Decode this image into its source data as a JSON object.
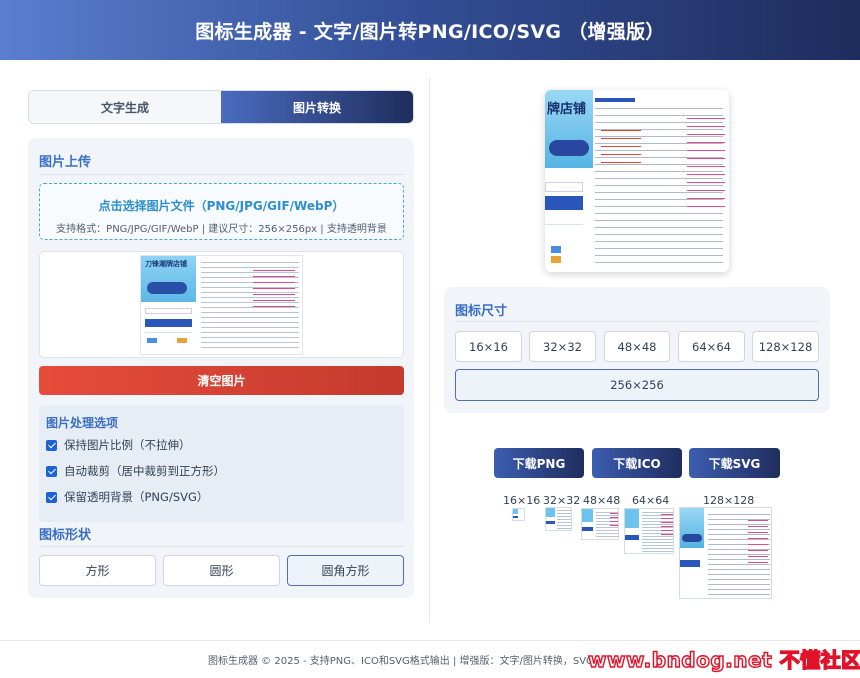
{
  "header": {
    "title": "图标生成器 - 文字/图片转PNG/ICO/SVG （增强版）"
  },
  "mode_tabs": [
    {
      "label": "文字生成",
      "active": false
    },
    {
      "label": "图片转换",
      "active": true
    }
  ],
  "upload": {
    "section_title": "图片上传",
    "dropzone_title": "点击选择图片文件（PNG/JPG/GIF/WebP）",
    "dropzone_hint": "支持格式：PNG/JPG/GIF/WebP | 建议尺寸：256×256px | 支持透明背景",
    "preview_image_title": "刀锋潮牌店铺",
    "clear_button": "清空图片"
  },
  "processing_options": {
    "title": "图片处理选项",
    "items": [
      {
        "label": "保持图片比例（不拉伸）",
        "checked": true
      },
      {
        "label": "自动裁剪（居中裁剪到正方形）",
        "checked": true
      },
      {
        "label": "保留透明背景（PNG/SVG）",
        "checked": true
      }
    ]
  },
  "shape": {
    "title": "图标形状",
    "options": [
      {
        "label": "方形",
        "active": false
      },
      {
        "label": "圆形",
        "active": false
      },
      {
        "label": "圆角方形",
        "active": true
      }
    ]
  },
  "main_preview": {
    "image_title": "牌店铺"
  },
  "icon_size": {
    "title": "图标尺寸",
    "options": [
      {
        "label": "16×16",
        "active": false
      },
      {
        "label": "32×32",
        "active": false
      },
      {
        "label": "48×48",
        "active": false
      },
      {
        "label": "64×64",
        "active": false
      },
      {
        "label": "128×128",
        "active": false
      },
      {
        "label": "256×256",
        "active": true
      }
    ]
  },
  "downloads": [
    {
      "label": "下载PNG"
    },
    {
      "label": "下载ICO"
    },
    {
      "label": "下载SVG"
    }
  ],
  "previews": [
    {
      "label": "16×16"
    },
    {
      "label": "32×32"
    },
    {
      "label": "48×48"
    },
    {
      "label": "64×64"
    },
    {
      "label": "128×128"
    }
  ],
  "footer": {
    "text": "图标生成器 © 2025 - 支持PNG、ICO和SVG格式输出 | 增强版：文字/图片转换，SVG"
  },
  "watermark": {
    "text": "www.bndog.net 不懂社区"
  },
  "colors": {
    "accent_blue": "#3a6fc4",
    "header_gradient_start": "#5a7fcf",
    "header_gradient_end": "#1e2c5c",
    "danger_red": "#e64c3c"
  }
}
